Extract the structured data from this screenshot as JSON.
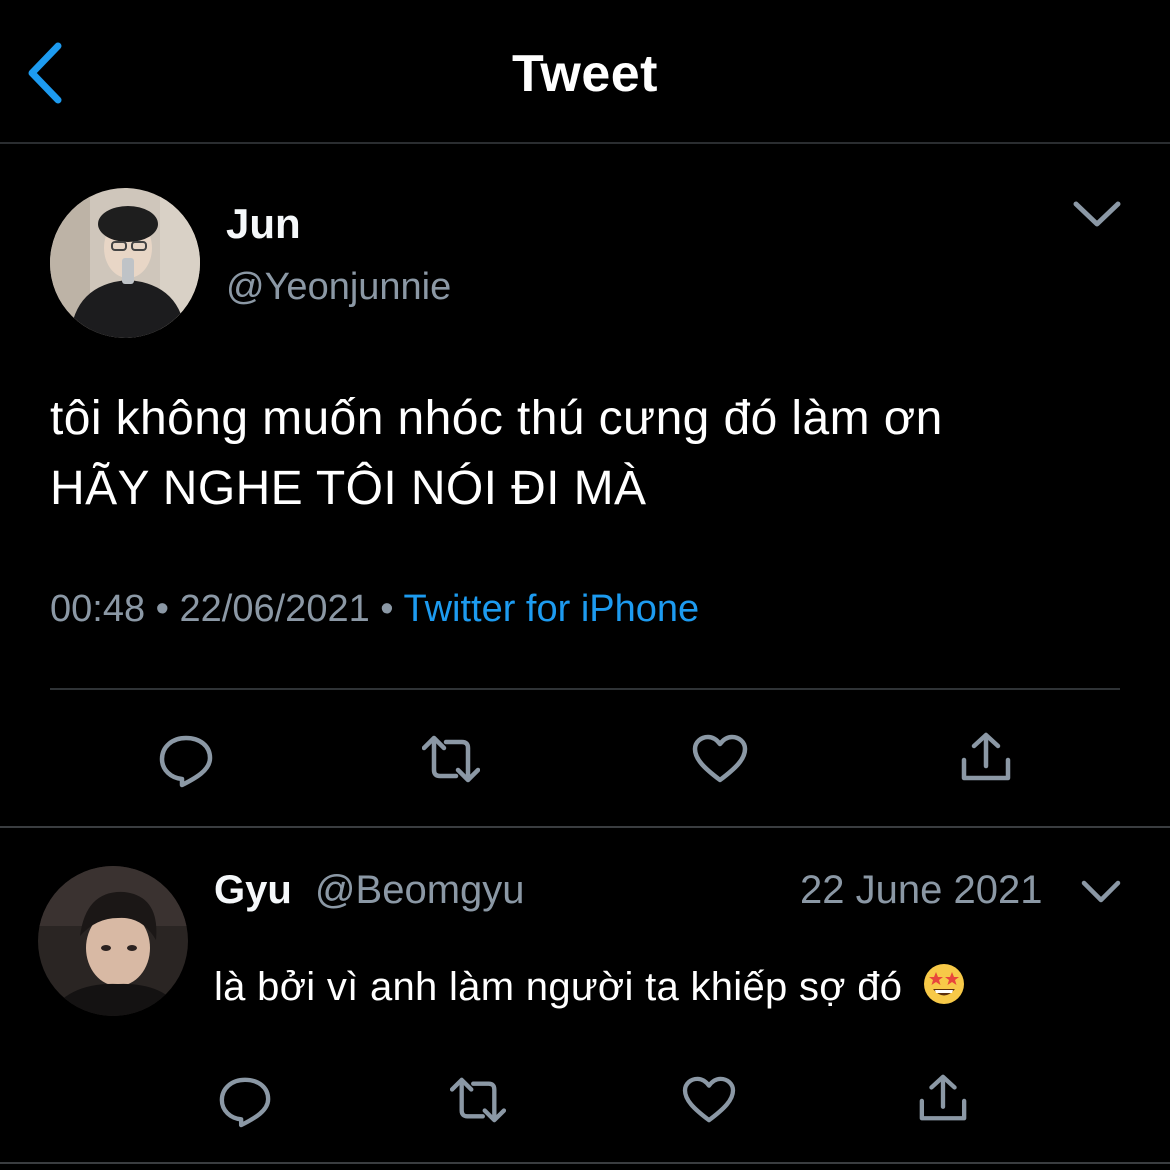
{
  "header": {
    "title": "Tweet",
    "back_icon": "chevron-left-icon"
  },
  "tweet": {
    "author_name": "Jun",
    "author_handle": "@Yeonjunnie",
    "text_lines": [
      "tôi không muốn nhóc thú cưng đó làm ơn",
      "HÃY NGHE TÔI NÓI ĐI MÀ"
    ],
    "time": "00:48",
    "separator": "•",
    "date": "22/06/2021",
    "source": "Twitter for iPhone",
    "actions": [
      "reply-icon",
      "retweet-icon",
      "like-icon",
      "share-icon"
    ]
  },
  "reply": {
    "author_name": "Gyu",
    "author_handle": "@Beomgyu",
    "date": "22 June 2021",
    "text": "là bởi vì anh làm người ta khiếp sợ đó",
    "emoji": "star-struck-emoji",
    "actions": [
      "reply-icon",
      "retweet-icon",
      "like-icon",
      "share-icon"
    ]
  },
  "colors": {
    "background": "#000000",
    "text": "#ffffff",
    "muted": "#8b98a5",
    "accent": "#1d9bf0",
    "divider": "#2f3336"
  }
}
